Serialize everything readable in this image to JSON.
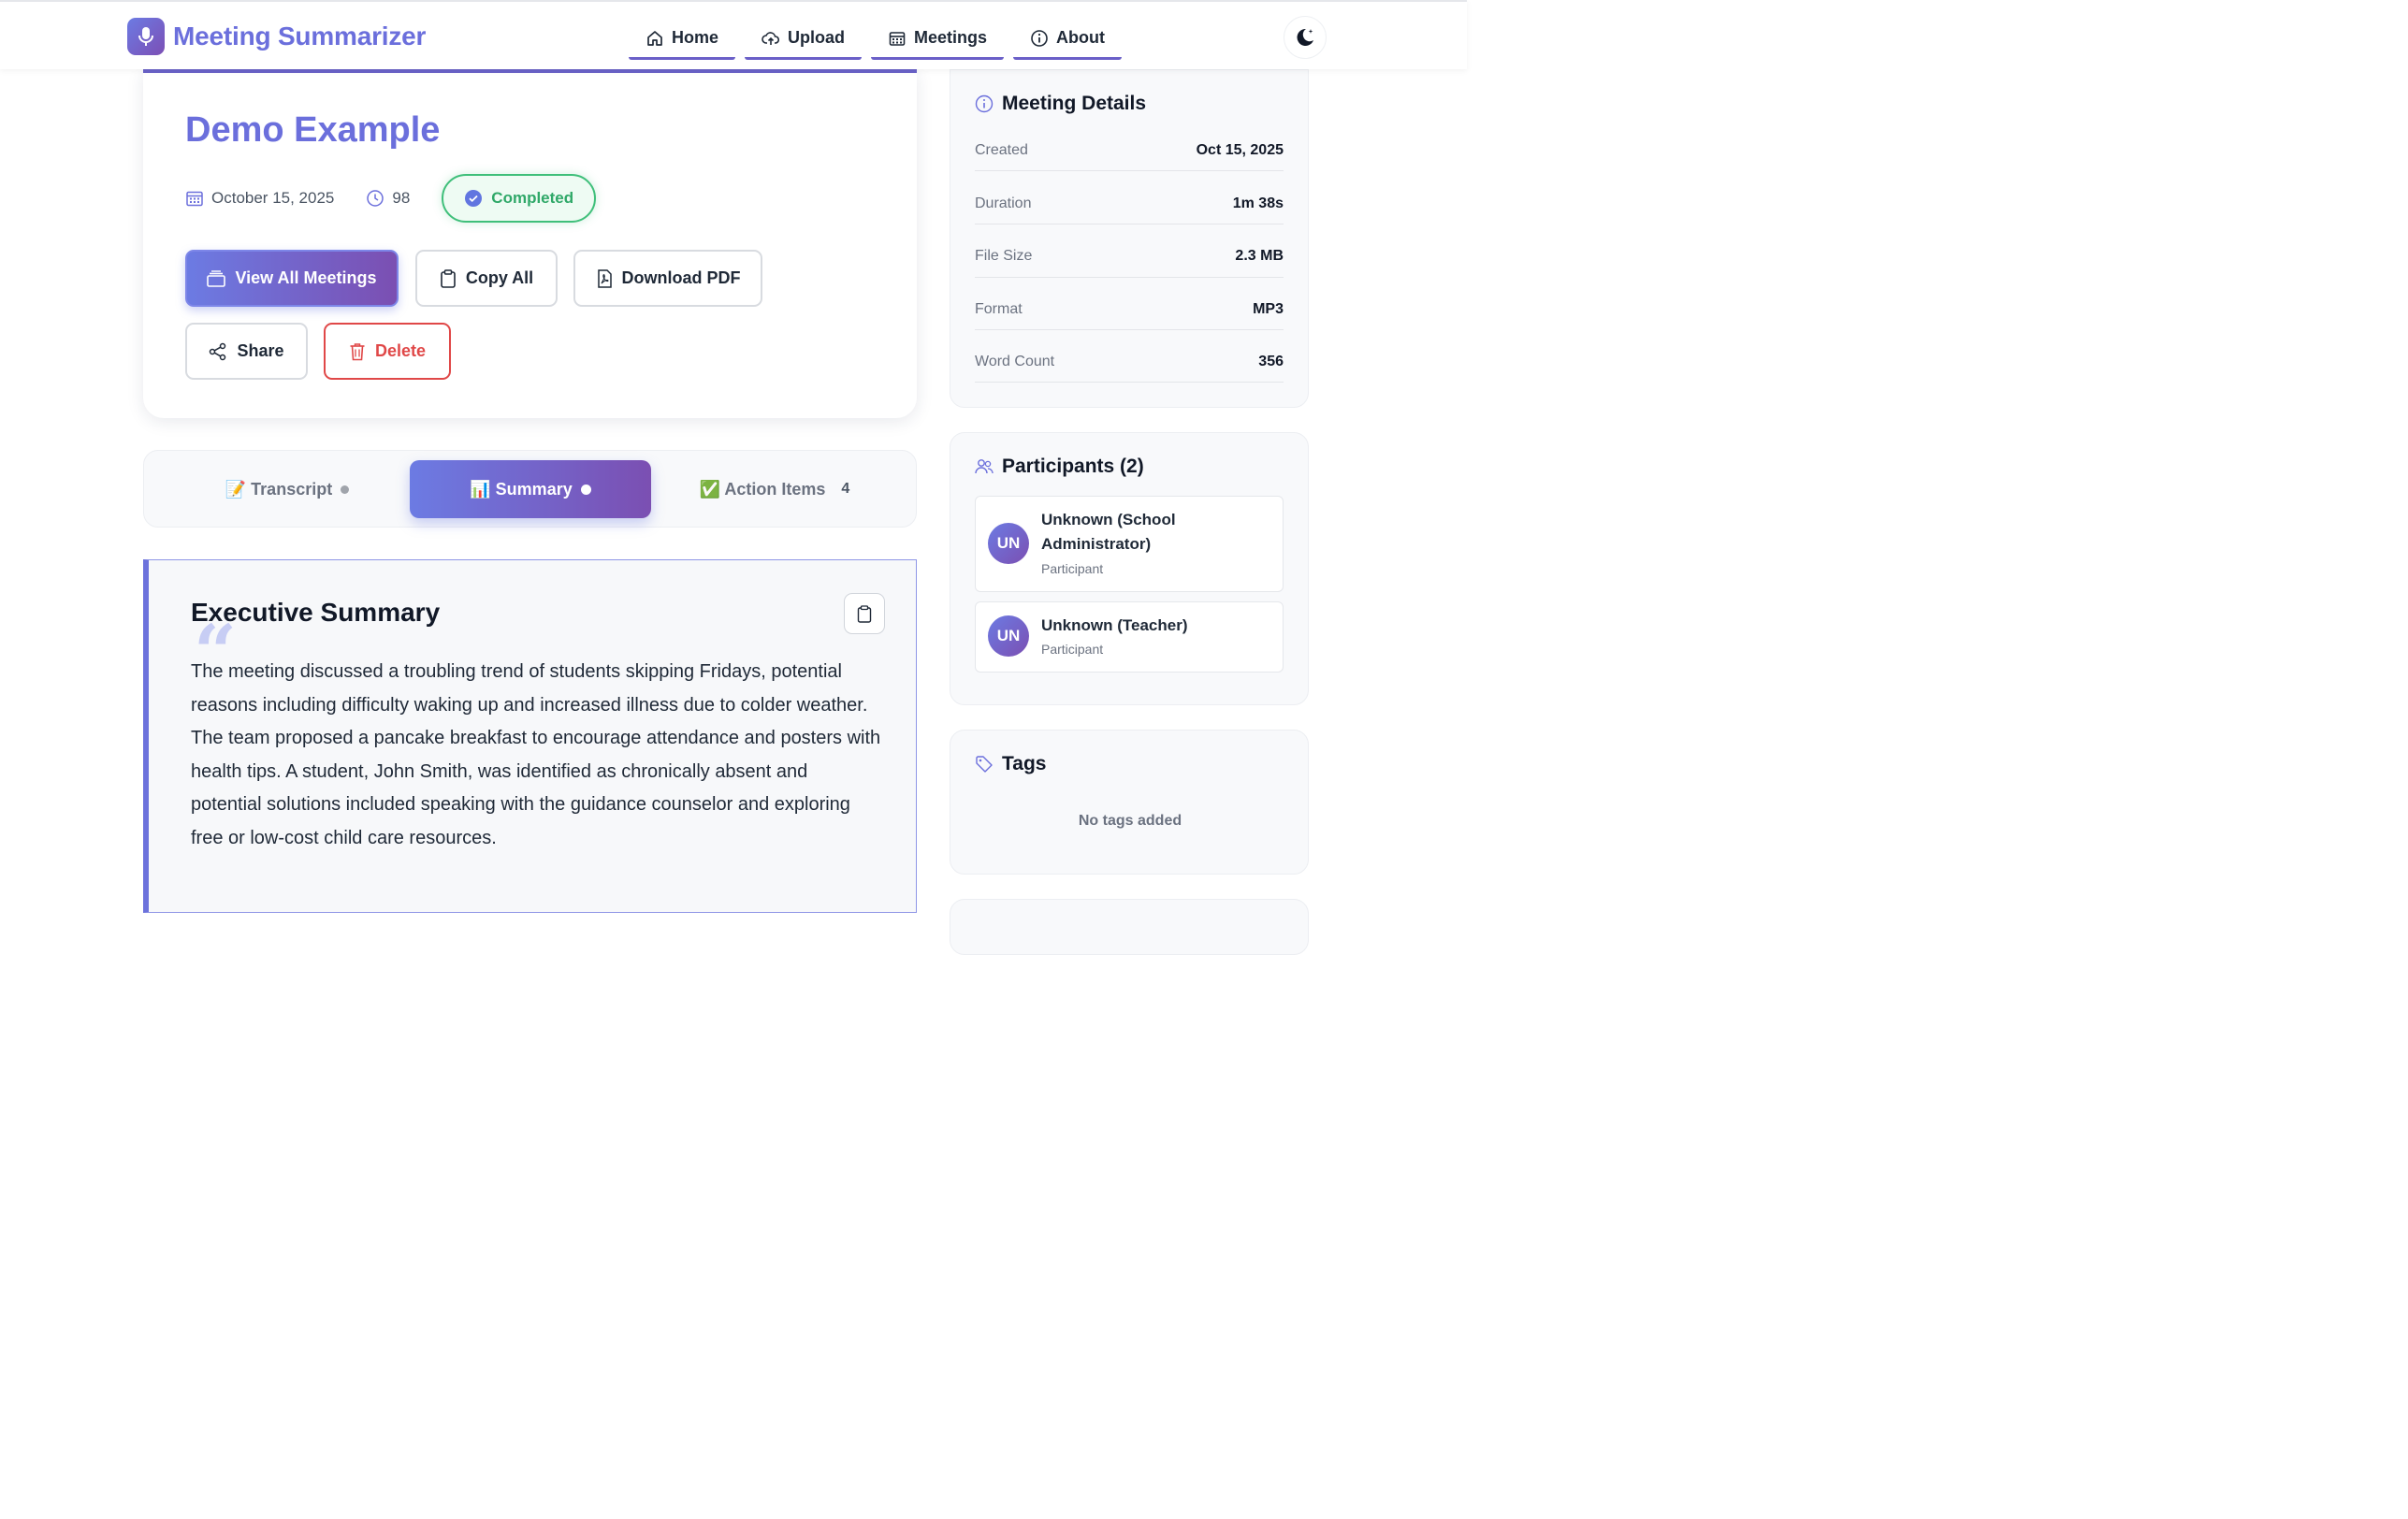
{
  "nav": {
    "brand": "Meeting Summarizer",
    "items": [
      {
        "label": "Home",
        "icon": "home-icon"
      },
      {
        "label": "Upload",
        "icon": "cloud-upload-icon"
      },
      {
        "label": "Meetings",
        "icon": "calendar-icon"
      },
      {
        "label": "About",
        "icon": "info-icon"
      }
    ],
    "theme_toggle_icon": "moon-star-icon"
  },
  "meeting": {
    "title": "Demo Example",
    "date": "October 15, 2025",
    "duration": "98",
    "status": "Completed"
  },
  "actions": {
    "view_all": "View All Meetings",
    "copy_all": "Copy All",
    "download_pdf": "Download PDF",
    "share": "Share",
    "delete": "Delete"
  },
  "tabs": [
    {
      "label": "📝 Transcript"
    },
    {
      "label": "📊 Summary"
    },
    {
      "label": "✅ Action Items",
      "count": "4"
    }
  ],
  "summary": {
    "title": "Executive Summary",
    "quote_glyph": "“",
    "text": "The meeting discussed a troubling trend of students skipping Fridays, potential reasons including difficulty waking up and increased illness due to colder weather. The team proposed a pancake breakfast to encourage attendance and posters with health tips. A student, John Smith, was identified as chronically absent and potential solutions included speaking with the guidance counselor and exploring free or low-cost child care resources."
  },
  "details": {
    "title": "Meeting Details",
    "rows": [
      {
        "key": "Created",
        "value": "Oct 15, 2025"
      },
      {
        "key": "Duration",
        "value": "1m 38s"
      },
      {
        "key": "File Size",
        "value": "2.3 MB"
      },
      {
        "key": "Format",
        "value": "MP3"
      },
      {
        "key": "Word Count",
        "value": "356"
      }
    ]
  },
  "participants": {
    "title": "Participants (2)",
    "list": [
      {
        "initials": "UN",
        "name": "Unknown (School Administrator)",
        "role": "Participant"
      },
      {
        "initials": "UN",
        "name": "Unknown (Teacher)",
        "role": "Participant"
      }
    ]
  },
  "tags": {
    "title": "Tags",
    "empty": "No tags added"
  },
  "colors": {
    "accent": "#6b6fdc",
    "accent_gradient_end": "#7b4fb2",
    "success": "#3fbf7a",
    "danger": "#e04848"
  }
}
